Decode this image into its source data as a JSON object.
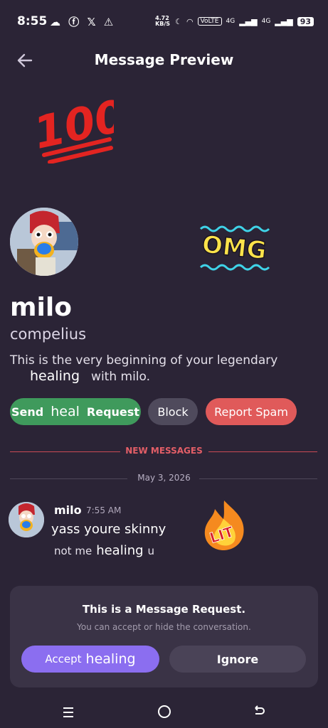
{
  "status": {
    "time": "8:55",
    "left_icons": "☁ ⓕ 𝕏 ⚠",
    "network_speed": "4.72 KB/S",
    "volte": "VoLTE",
    "signal1": "4G",
    "signal2": "4G",
    "battery": "93"
  },
  "header": {
    "title": "Message Preview"
  },
  "stickers": {
    "omg": "OMG",
    "lit": "LIT",
    "hundred": "100"
  },
  "profile": {
    "name": "milo",
    "handle": "compelius",
    "intro_line1": "This is the very beginning of your legendary",
    "intro_big": "healing",
    "intro_line2": "with milo."
  },
  "actions": {
    "send_pre": "Send",
    "send_big": "heal",
    "send_post": "Request",
    "block": "Block",
    "report": "Report Spam"
  },
  "dividers": {
    "new_messages": "NEW MESSAGES",
    "date": "May 3, 2026"
  },
  "message": {
    "author": "milo",
    "time": "7:55 AM",
    "line1": "yass youre skinny",
    "line2_pre": "not me",
    "line2_big": "healing",
    "line2_post": "u"
  },
  "request_panel": {
    "title": "This is a Message Request.",
    "subtitle": "You can accept or hide the conversation.",
    "accept_pre": "Accept",
    "accept_big": "healing",
    "ignore": "Ignore"
  },
  "colors": {
    "background": "#2b2436",
    "send_green": "#3f9a5c",
    "report_red": "#e05a5a",
    "accept_purple": "#8b6ef0"
  }
}
